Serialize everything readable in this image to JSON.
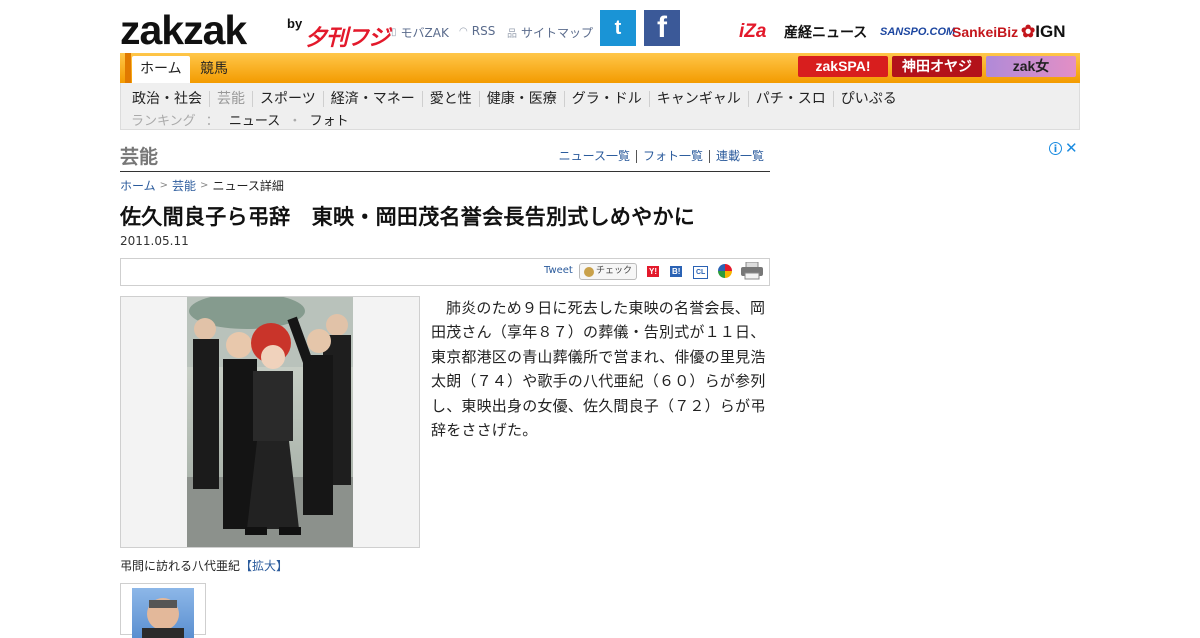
{
  "header": {
    "logo": {
      "main": "zakzak",
      "by": "by",
      "brand": "夕刊フジ"
    },
    "links": [
      {
        "icon": "mobile-icon",
        "label": "モバZAK"
      },
      {
        "icon": "rss-icon",
        "label": "RSS"
      },
      {
        "icon": "sitemap-icon",
        "label": "サイトマップ"
      }
    ],
    "social": {
      "twitter_glyph": "t",
      "facebook_glyph": "f"
    },
    "partners": [
      "iZa",
      "産経ニュース",
      "SANSPO.COM",
      "SankeiBiz",
      "IGN"
    ]
  },
  "nav": {
    "tabs": [
      "ホーム",
      "競馬"
    ],
    "banners": [
      "zakSPA!",
      "神田オヤジ",
      "zak女"
    ],
    "categories": [
      "政治・社会",
      "芸能",
      "スポーツ",
      "経済・マネー",
      "愛と性",
      "健康・医療",
      "グラ・ドル",
      "キャンギャル",
      "パチ・スロ",
      "ぴいぷる"
    ],
    "ranking": {
      "label": "ランキング",
      "sep": "：",
      "items": [
        "ニュース",
        "フォト"
      ],
      "dot": "・"
    }
  },
  "section": {
    "title": "芸能",
    "links": [
      "ニュース一覧",
      "フォト一覧",
      "連載一覧"
    ]
  },
  "breadcrumb": [
    "ホーム",
    "芸能",
    "ニュース詳細"
  ],
  "article": {
    "headline": "佐久間良子ら弔辞　東映・岡田茂名誉会長告別式しめやかに",
    "date": "2011.05.11",
    "body": "肺炎のため９日に死去した東映の名誉会長、岡田茂さん（享年８７）の葬儀・告別式が１１日、東京都港区の青山葬儀所で営まれ、俳優の里見浩太朗（７４）や歌手の八代亜紀（６０）らが参列し、東映出身の女優、佐久間良子（７２）らが弔辞をささげた。",
    "caption": "弔問に訪れる八代亜紀",
    "enlarge": "【拡大】"
  },
  "share": {
    "tweet": "Tweet",
    "check": "チェック",
    "icons": [
      "yahoo-bookmark-icon",
      "hatena-bookmark-icon",
      "clip-icon",
      "google-icon",
      "print-icon"
    ]
  },
  "ad": {
    "info": "i",
    "close": "✕"
  }
}
